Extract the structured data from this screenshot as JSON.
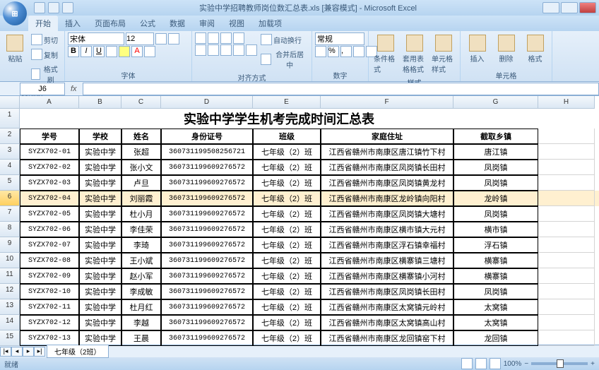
{
  "window_title": "实验中学招聘教师岗位数汇总表.xls [兼容模式] - Microsoft Excel",
  "orb": "⊞",
  "tabs": {
    "home": "开始",
    "insert": "插入",
    "layout": "页面布局",
    "formulas": "公式",
    "data": "数据",
    "review": "审阅",
    "view": "视图",
    "addin": "加载项"
  },
  "ribbon": {
    "clipboard": {
      "paste": "粘贴",
      "cut": "剪切",
      "copy": "复制",
      "format_painter": "格式刷",
      "label": "剪贴板"
    },
    "font": {
      "name": "宋体",
      "size": "12",
      "label": "字体"
    },
    "alignment": {
      "wrap": "自动换行",
      "merge": "合并后居中",
      "label": "对齐方式"
    },
    "number": {
      "format": "常规",
      "label": "数字"
    },
    "styles": {
      "cond": "条件格式",
      "table": "套用表格格式",
      "cell": "单元格样式",
      "label": "样式"
    },
    "cells": {
      "insert": "插入",
      "delete": "删除",
      "format": "格式",
      "label": "单元格"
    }
  },
  "name_box": "J6",
  "fx_label": "fx",
  "columns": [
    "A",
    "B",
    "C",
    "D",
    "E",
    "F",
    "G",
    "H"
  ],
  "col_classes": [
    "cw-A",
    "cw-B",
    "cw-C",
    "cw-D",
    "cw-E",
    "cw-F",
    "cw-G",
    "cw-H"
  ],
  "title": "实验中学学生机考完成时间汇总表",
  "headers": [
    "学号",
    "学校",
    "姓名",
    "身份证号",
    "班级",
    "家庭住址",
    "截取乡镇"
  ],
  "rows": [
    {
      "r": 3,
      "cells": [
        "SYZX702-01",
        "实验中学",
        "张超",
        "360731199508256721",
        "七年级（2）班",
        "江西省赣州市南康区唐江镇竹下村",
        "唐江镇"
      ]
    },
    {
      "r": 4,
      "cells": [
        "SYZX702-02",
        "实验中学",
        "张小文",
        "360731199609276572",
        "七年级（2）班",
        "江西省赣州市南康区凤岗镇长田村",
        "凤岗镇"
      ]
    },
    {
      "r": 5,
      "cells": [
        "SYZX702-03",
        "实验中学",
        "卢旦",
        "360731199609276572",
        "七年级（2）班",
        "江西省赣州市南康区凤岗镇黄龙村",
        "凤岗镇"
      ]
    },
    {
      "r": 6,
      "cells": [
        "SYZX702-04",
        "实验中学",
        "刘丽霞",
        "360731199609276572",
        "七年级（2）班",
        "江西省赣州市南康区龙岭镇向阳村",
        "龙岭镇"
      ]
    },
    {
      "r": 7,
      "cells": [
        "SYZX702-05",
        "实验中学",
        "杜小月",
        "360731199609276572",
        "七年级（2）班",
        "江西省赣州市南康区凤岗镇大塘村",
        "凤岗镇"
      ]
    },
    {
      "r": 8,
      "cells": [
        "SYZX702-06",
        "实验中学",
        "李佳荣",
        "360731199609276572",
        "七年级（2）班",
        "江西省赣州市南康区横市镇大元村",
        "横市镇"
      ]
    },
    {
      "r": 9,
      "cells": [
        "SYZX702-07",
        "实验中学",
        "李琦",
        "360731199609276572",
        "七年级（2）班",
        "江西省赣州市南康区浮石镇幸福村",
        "浮石镇"
      ]
    },
    {
      "r": 10,
      "cells": [
        "SYZX702-08",
        "实验中学",
        "王小斌",
        "360731199609276572",
        "七年级（2）班",
        "江西省赣州市南康区横寨镇三塘村",
        "横寨镇"
      ]
    },
    {
      "r": 11,
      "cells": [
        "SYZX702-09",
        "实验中学",
        "赵小军",
        "360731199609276572",
        "七年级（2）班",
        "江西省赣州市南康区横寨镇小河村",
        "横寨镇"
      ]
    },
    {
      "r": 12,
      "cells": [
        "SYZX702-10",
        "实验中学",
        "李成敏",
        "360731199609276572",
        "七年级（2）班",
        "江西省赣州市南康区凤岗镇长田村",
        "凤岗镇"
      ]
    },
    {
      "r": 13,
      "cells": [
        "SYZX702-11",
        "实验中学",
        "杜月红",
        "360731199609276572",
        "七年级（2）班",
        "江西省赣州市南康区太窝镇元岭村",
        "太窝镇"
      ]
    },
    {
      "r": 14,
      "cells": [
        "SYZX702-12",
        "实验中学",
        "李越",
        "360731199609276572",
        "七年级（2）班",
        "江西省赣州市南康区太窝镇高山村",
        "太窝镇"
      ]
    },
    {
      "r": 15,
      "cells": [
        "SYZX702-13",
        "实验中学",
        "王晨",
        "360731199609276572",
        "七年级（2）班",
        "江西省赣州市南康区龙回镇窑下村",
        "龙回镇"
      ]
    }
  ],
  "selected_row": 6,
  "sheet_tab": "七年级（2班）",
  "status": "就绪",
  "zoom": "100%"
}
